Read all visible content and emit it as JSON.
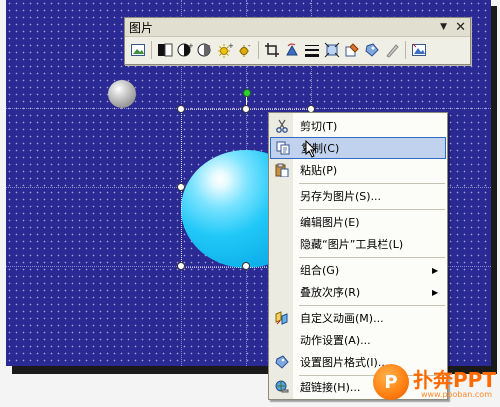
{
  "toolbar": {
    "title": "图片",
    "dropdown_icon": "▼",
    "close_icon": "✕",
    "buttons": [
      "insert-picture-icon",
      "color-icon",
      "more-contrast-icon",
      "less-contrast-icon",
      "more-brightness-icon",
      "less-brightness-icon",
      "crop-icon",
      "rotate-left-icon",
      "line-style-icon",
      "compress-pictures-icon",
      "recolor-picture-icon",
      "format-picture-icon",
      "set-transparent-color-icon",
      "reset-picture-icon"
    ]
  },
  "menu": {
    "items": [
      {
        "label": "剪切(T)",
        "icon": "scissors-icon"
      },
      {
        "label": "复制(C)",
        "icon": "copy-icon",
        "highlighted": true
      },
      {
        "label": "粘贴(P)",
        "icon": "paste-icon"
      },
      {
        "label": "另存为图片(S)...",
        "icon": ""
      },
      {
        "label": "编辑图片(E)",
        "icon": ""
      },
      {
        "label": "隐藏“图片”工具栏(L)",
        "icon": ""
      },
      {
        "label": "组合(G)",
        "icon": "",
        "submenu": true
      },
      {
        "label": "叠放次序(R)",
        "icon": "",
        "submenu": true
      },
      {
        "label": "自定义动画(M)...",
        "icon": "custom-animation-icon"
      },
      {
        "label": "动作设置(A)...",
        "icon": ""
      },
      {
        "label": "设置图片格式(I)...",
        "icon": "format-picture-icon"
      },
      {
        "label": "超链接(H)...",
        "icon": "hyperlink-icon"
      }
    ]
  },
  "watermark": {
    "logo_letter": "P",
    "brand": "扑奔PPT",
    "url": "www.pooban.com"
  },
  "colors": {
    "slide_background": "#2b2a95",
    "menu_highlight": "#c1d2ee",
    "menu_highlight_border": "#316ac5",
    "big_sphere": "#20c8f7",
    "rotation_handle": "#2fd12f",
    "watermark": "#ff6a00"
  }
}
